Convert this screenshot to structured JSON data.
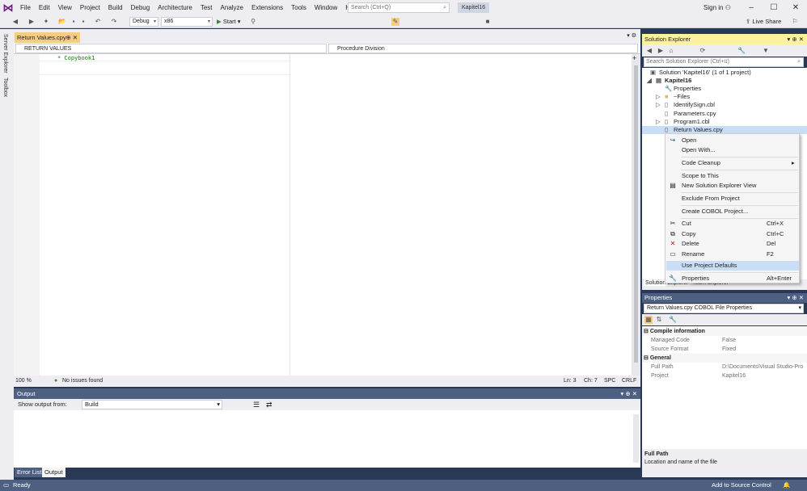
{
  "menubar": {
    "items": [
      "File",
      "Edit",
      "View",
      "Project",
      "Build",
      "Debug",
      "Architecture",
      "Test",
      "Analyze",
      "Extensions",
      "Tools",
      "Window",
      "Help"
    ],
    "search_placeholder": "Search (Ctrl+Q)",
    "solution_badge": "Kapitel16",
    "signin": "Sign in"
  },
  "toolbar": {
    "config": "Debug",
    "platform": "x86",
    "start": "Start",
    "liveshare": "Live Share"
  },
  "left_strip": {
    "tabs": [
      "Server Explorer",
      "Toolbox"
    ]
  },
  "editor": {
    "tab_label": "Return Values.cpy",
    "nav_left": "RETURN VALUES",
    "nav_right": "Procedure Division",
    "code_line": "* Copybook1",
    "zoom": "100 %",
    "issues": "No issues found",
    "ln": "Ln: 3",
    "ch": "Ch: 7",
    "spc": "SPC",
    "crlf": "CRLF"
  },
  "output": {
    "title": "Output",
    "show_from_label": "Show output from:",
    "source": "Build",
    "tabs": [
      "Error List",
      "Output"
    ]
  },
  "statusbar": {
    "ready": "Ready",
    "source_control": "Add to Source Control"
  },
  "solution_explorer": {
    "title": "Solution Explorer",
    "search_placeholder": "Search Solution Explorer (Ctrl+ü)",
    "tree": [
      {
        "label": "Solution 'Kapitel16' (1 of 1 project)",
        "indent": 0,
        "icon": "solution-icon"
      },
      {
        "label": "Kapitel16",
        "indent": 1,
        "icon": "project-icon",
        "bold": true
      },
      {
        "label": "Properties",
        "indent": 2,
        "icon": "wrench-icon"
      },
      {
        "label": "~Files",
        "indent": 2,
        "icon": "folder-icon"
      },
      {
        "label": "IdentifySign.cbl",
        "indent": 2,
        "icon": "file-icon"
      },
      {
        "label": "Parameters.cpy",
        "indent": 2,
        "icon": "file-icon"
      },
      {
        "label": "Program1.cbl",
        "indent": 2,
        "icon": "file-icon"
      },
      {
        "label": "Return Values.cpy",
        "indent": 2,
        "icon": "file-icon",
        "selected": true
      }
    ],
    "bottom_tabs": [
      "Solution Explorer",
      "Team Explorer"
    ]
  },
  "context_menu": {
    "items": [
      {
        "label": "Open",
        "shortcut": "",
        "icon": "open-icon"
      },
      {
        "label": "Open With...",
        "shortcut": ""
      },
      {
        "label": "Code Cleanup",
        "shortcut": "",
        "submenu": true
      },
      {
        "label": "Scope to This",
        "shortcut": ""
      },
      {
        "label": "New Solution Explorer View",
        "shortcut": "",
        "icon": "new-view-icon"
      },
      {
        "label": "Exclude From Project",
        "shortcut": ""
      },
      {
        "label": "Create COBOL Project...",
        "shortcut": ""
      },
      {
        "label": "Cut",
        "shortcut": "Ctrl+X",
        "icon": "cut-icon"
      },
      {
        "label": "Copy",
        "shortcut": "Ctrl+C",
        "icon": "copy-icon"
      },
      {
        "label": "Delete",
        "shortcut": "Del",
        "icon": "delete-icon"
      },
      {
        "label": "Rename",
        "shortcut": "F2",
        "icon": "rename-icon"
      },
      {
        "label": "Use Project Defaults",
        "shortcut": "",
        "highlighted": true
      },
      {
        "label": "Properties",
        "shortcut": "Alt+Enter",
        "icon": "wrench-icon"
      }
    ]
  },
  "properties": {
    "title": "Properties",
    "object": "Return Values.cpy  COBOL File Properties",
    "categories": [
      {
        "name": "Compile information",
        "rows": [
          [
            "Managed Code",
            "False"
          ],
          [
            "Source Format",
            "Fixed"
          ]
        ]
      },
      {
        "name": "General",
        "rows": [
          [
            "Full Path",
            "D:\\Documents\\Visual Studio-Pro"
          ],
          [
            "Project",
            "Kapitel16"
          ]
        ]
      }
    ],
    "desc_title": "Full Path",
    "desc_text": "Location and name of the file"
  },
  "colors": {
    "accent": "#4d6082",
    "background": "#293955",
    "tab_active": "#f5cc84",
    "highlight": "#c9def5"
  }
}
